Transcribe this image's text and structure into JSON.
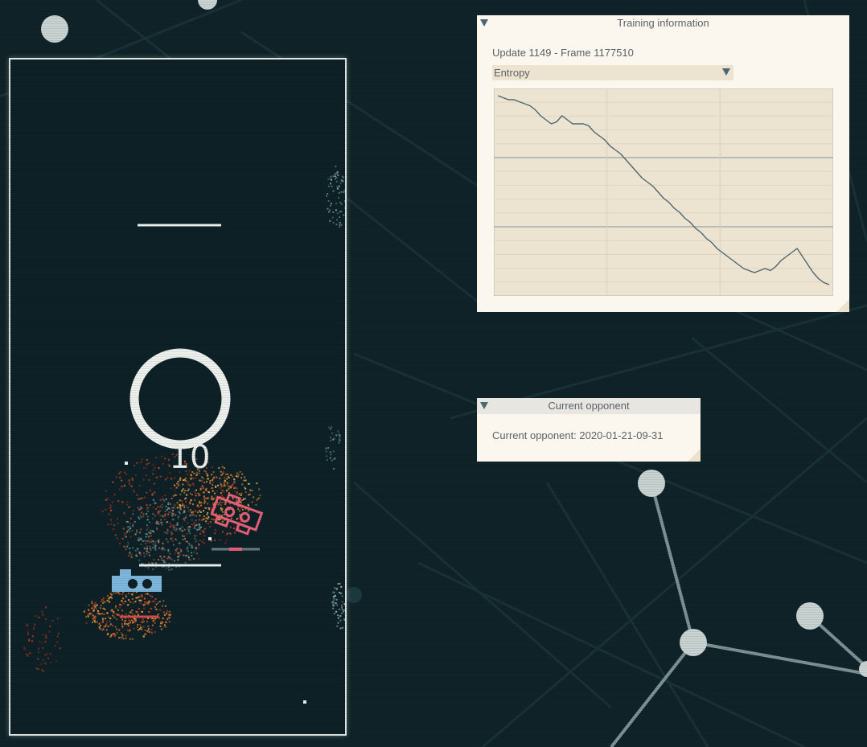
{
  "game": {
    "timer_value": "10"
  },
  "training_panel": {
    "title": "Training information",
    "update_text": "Update 1149 - Frame 1177510",
    "selected_metric": "Entropy"
  },
  "opponent_panel": {
    "title": "Current opponent",
    "opponent_text": "Current opponent: 2020-01-21-09-31"
  },
  "chart_data": {
    "type": "line",
    "title": "",
    "xlabel": "",
    "ylabel": "",
    "grid": true,
    "series": [
      {
        "values": [
          0.98,
          0.97,
          0.96,
          0.96,
          0.95,
          0.94,
          0.93,
          0.91,
          0.88,
          0.86,
          0.84,
          0.85,
          0.88,
          0.86,
          0.84,
          0.84,
          0.84,
          0.83,
          0.8,
          0.78,
          0.76,
          0.73,
          0.71,
          0.69,
          0.66,
          0.63,
          0.6,
          0.57,
          0.55,
          0.53,
          0.5,
          0.47,
          0.45,
          0.42,
          0.4,
          0.37,
          0.35,
          0.32,
          0.3,
          0.27,
          0.25,
          0.22,
          0.2,
          0.18,
          0.16,
          0.14,
          0.12,
          0.11,
          0.1,
          0.11,
          0.12,
          0.11,
          0.13,
          0.16,
          0.18,
          0.2,
          0.22,
          0.18,
          0.14,
          0.1,
          0.07,
          0.05,
          0.04
        ]
      }
    ]
  },
  "colors": {
    "background": "#0f2328",
    "arena_border": "#dfe6e4",
    "panel_bg": "#fbf7ee",
    "chart_bg": "#ece4d0",
    "chart_line": "#4e6672",
    "enemy_ship": "#e8607a",
    "player_ship": "#7fb8de"
  }
}
